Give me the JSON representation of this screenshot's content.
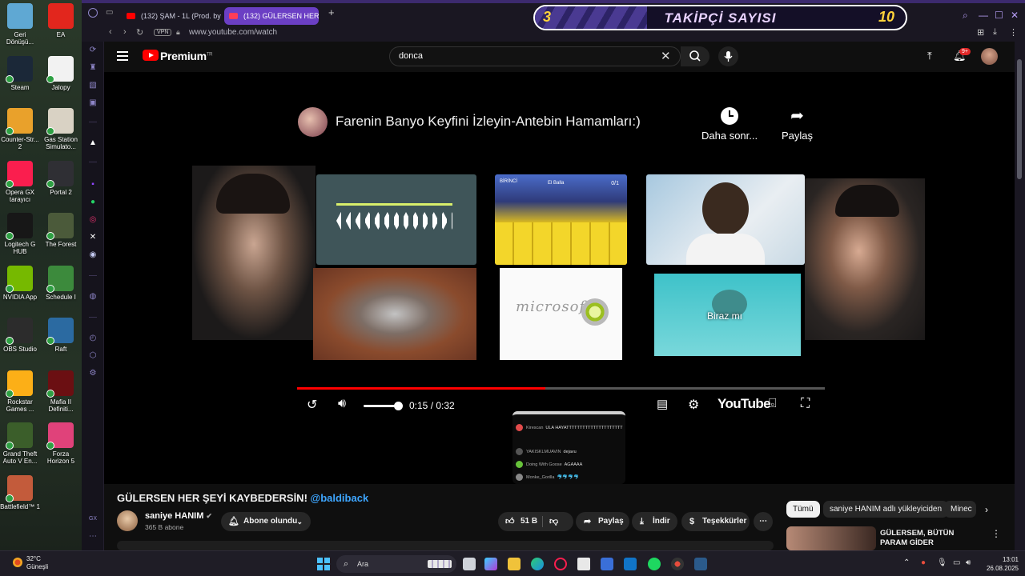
{
  "desktop": {
    "icons": [
      {
        "label": "Geri Dönüşü...",
        "color": "#5fa8d3"
      },
      {
        "label": "EA",
        "color": "#e2261d"
      },
      {
        "label": "Steam",
        "color": "#1b2838"
      },
      {
        "label": "Jalopy",
        "color": "#f2f2f2"
      },
      {
        "label": "Counter-Str... 2",
        "color": "#e9a12b"
      },
      {
        "label": "Gas Station Simulato...",
        "color": "#d9d2c4"
      },
      {
        "label": "Opera GX tarayıcı",
        "color": "#fa1e4e"
      },
      {
        "label": "Portal 2",
        "color": "#2f2f34"
      },
      {
        "label": "Logitech G HUB",
        "color": "#171717"
      },
      {
        "label": "The Forest",
        "color": "#4b5a3a"
      },
      {
        "label": "NVIDIA App",
        "color": "#76b900"
      },
      {
        "label": "Schedule I",
        "color": "#3c8a3c"
      },
      {
        "label": "OBS Studio",
        "color": "#2c2c2c"
      },
      {
        "label": "Raft",
        "color": "#2b6aa1"
      },
      {
        "label": "Rockstar Games ...",
        "color": "#fcaf17"
      },
      {
        "label": "Mafia II Definiti...",
        "color": "#6b0f12"
      },
      {
        "label": "Grand Theft Auto V En...",
        "color": "#3b5e2a"
      },
      {
        "label": "Forza Horizon 5",
        "color": "#e0427a"
      },
      {
        "label": "Battlefield™ 1",
        "color": "#c35b3b"
      }
    ]
  },
  "browser": {
    "tabs": [
      {
        "label": "(132) ŞAM - 1L (Prod. by ..."
      },
      {
        "label": "(132) GÜLERSEN HER..."
      }
    ],
    "vpn_label": "VPN",
    "url": "www.youtube.com/watch"
  },
  "overlay": {
    "left_number": "3",
    "title": "TAKİPÇİ SAYISI",
    "right_number": "10"
  },
  "youtube": {
    "brand": "Premium",
    "brand_sup": "TR",
    "search_value": "donca",
    "notification_count": "9+",
    "player": {
      "video_title": "Farenin Banyo Keyfini İzleyin-Antebin Hamamları:)",
      "later_label": "Daha sonr...",
      "share_label": "Paylaş",
      "time": "0:15 / 0:32",
      "progress": 0.47,
      "volume": 1.0,
      "yt_wordmark": "YouTube",
      "tile_texts": {
        "game_top_left": "BİRİNCİ",
        "game_top_mid": "El Balla",
        "game_top_right": "0/1",
        "logo_text": "microsoft",
        "cartoon_text": "Biraz mı"
      },
      "chat": [
        {
          "user": "Kirescan",
          "text": "ULA HAYATTTTTTTTTTTTTTTTTTTTT",
          "color": "#e24b4b"
        },
        {
          "user": "YAKISKLMUAVIN",
          "text": "dejavu",
          "color": "#555555"
        },
        {
          "user": "Doing With Goose",
          "text": "AGAAAA",
          "color": "#67c23a"
        },
        {
          "user": "Monke_Gorilla",
          "text": "🐬🐬🐬🐬",
          "color": "#888888"
        }
      ]
    },
    "video": {
      "title": "GÜLERSEN HER ŞEYİ KAYBEDERSİN!",
      "title_tag": "@baldiback",
      "channel": "saniye HANIM",
      "subscribers": "365 B abone",
      "subscribe_label": "Abone olundu",
      "likes": "51 B",
      "share": "Paylaş",
      "download": "İndir",
      "thanks": "Teşekkürler"
    },
    "chips": [
      {
        "label": "Tümü",
        "selected": true
      },
      {
        "label": "saniye HANIM adlı yükleyiciden",
        "selected": false
      },
      {
        "label": "Minec",
        "selected": false
      }
    ],
    "recommended_title": "GÜLERSEM, BÜTÜN PARAM GİDER"
  },
  "taskbar": {
    "weather_temp": "32°C",
    "weather_desc": "Güneşli",
    "search_placeholder": "Ara",
    "time": "13:01",
    "date": "26.08.2025"
  }
}
